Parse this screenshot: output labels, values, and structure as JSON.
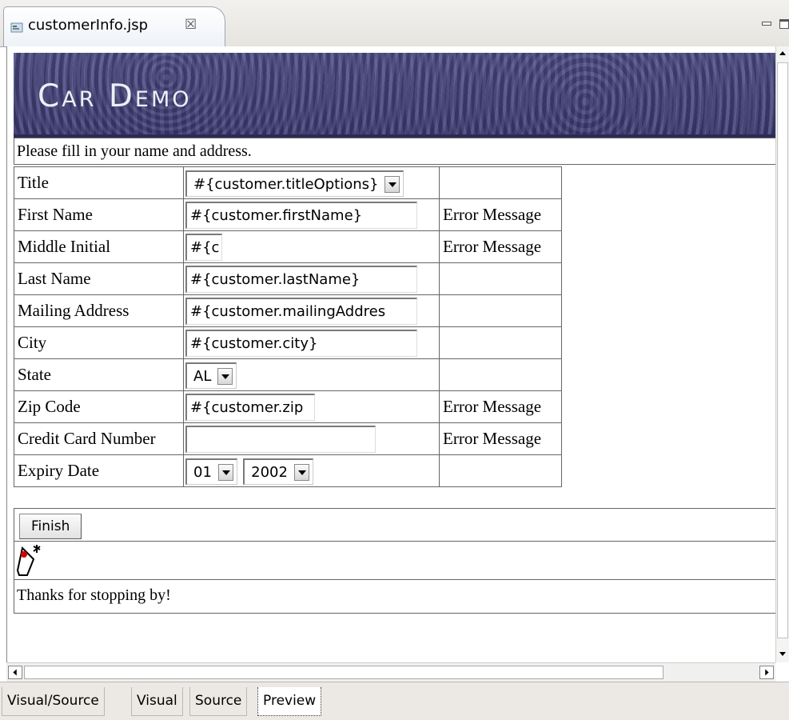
{
  "editor": {
    "tab_title": "customerInfo.jsp",
    "tab_close": "☒"
  },
  "page": {
    "banner_title": "Car Demo",
    "intro": "Please fill in your name and address.",
    "rows": [
      {
        "label": "Title",
        "value": "#{customer.titleOptions}",
        "error": ""
      },
      {
        "label": "First Name",
        "value": "#{customer.firstName}",
        "error": "Error Message"
      },
      {
        "label": "Middle Initial",
        "value": "#{c",
        "error": "Error Message"
      },
      {
        "label": "Last Name",
        "value": "#{customer.lastName}",
        "error": ""
      },
      {
        "label": "Mailing Address",
        "value": "#{customer.mailingAddres",
        "error": ""
      },
      {
        "label": "City",
        "value": "#{customer.city}",
        "error": ""
      },
      {
        "label": "State",
        "value": "AL",
        "error": ""
      },
      {
        "label": "Zip Code",
        "value": "#{customer.zip",
        "error": "Error Message"
      },
      {
        "label": "Credit Card Number",
        "value": "",
        "error": "Error Message"
      },
      {
        "label": "Expiry Date",
        "month": "01",
        "year": "2002",
        "error": ""
      }
    ],
    "finish_label": "Finish",
    "thanks": "Thanks for stopping by!"
  },
  "bottom_tabs": [
    "Visual/Source",
    "Visual",
    "Source",
    "Preview"
  ],
  "active_tab": "Preview",
  "icons": [
    "jsp-file-icon",
    "minimize-icon",
    "maximize-icon",
    "duke-mascot-icon",
    "scroll-up-arrow-icon",
    "scroll-down-arrow-icon",
    "scroll-left-arrow-icon",
    "scroll-right-arrow-icon"
  ]
}
